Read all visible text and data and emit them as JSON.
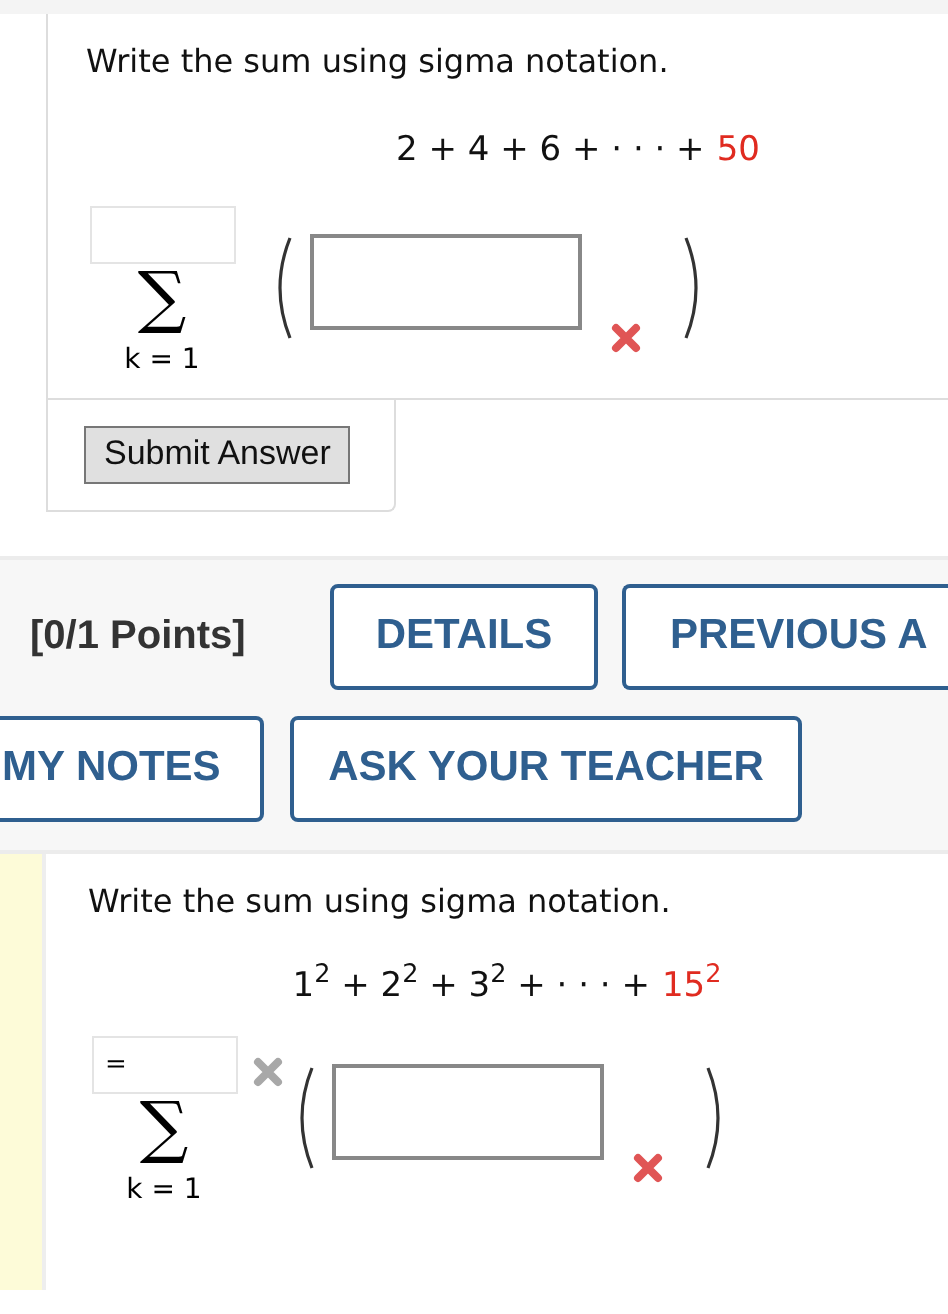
{
  "question_1": {
    "prompt": "Write the sum using sigma notation.",
    "expression": [
      {
        "text": "2 + 4 + 6 + · · · +",
        "highlight": false
      },
      {
        "text": "50",
        "highlight": true
      }
    ],
    "sigma": {
      "symbol": "∑",
      "index": "k = 1",
      "upper_limit": {
        "marked": false
      },
      "term": {
        "marked": true,
        "greyed": false
      }
    },
    "submit_button": "Submit Answer"
  },
  "question_2_header": {
    "points": "[0/1 Points]",
    "buttons": [
      [
        "DETAILS",
        "PREVIOUS A"
      ],
      [
        "MY NOTES",
        "ASK YOUR TEACHER"
      ]
    ]
  },
  "question_2": {
    "prompt": "Write the sum using sigma notation.",
    "expression": [
      {
        "text": "1$^{2}$ + 2$^{2}$ + 3$^{2}$ + · · · +",
        "highlight": false
      },
      {
        "text": "15$^{2}$",
        "highlight": true
      }
    ],
    "sigma": {
      "symbol": "∑",
      "index": "k = 1",
      "upper_limit": {
        "value": "=",
        "marked": true,
        "greyed": true
      },
      "term": {
        "marked": true,
        "greyed": false
      }
    }
  }
}
